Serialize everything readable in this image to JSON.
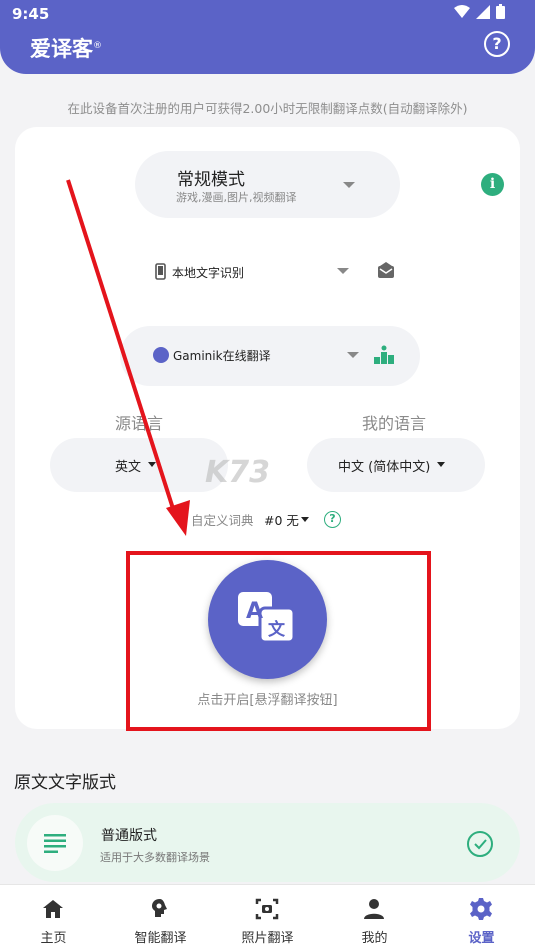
{
  "status_bar": {
    "time": "9:45"
  },
  "header": {
    "app_title": "爱译客",
    "registered_mark": "®",
    "help_icon": "help-circle-icon"
  },
  "notice": "在此设备首次注册的用户可获得2.00小时无限制翻译点数(自动翻译除外)",
  "mode": {
    "title": "常规模式",
    "subtitle": "游戏,漫画,图片,视频翻译"
  },
  "ocr": {
    "label": "本地文字识别"
  },
  "translator": {
    "label": "Gaminik在线翻译"
  },
  "languages": {
    "source_heading": "源语言",
    "target_heading": "我的语言",
    "source_value": "英文",
    "target_value": "中文 (简体中文)"
  },
  "dictionary": {
    "label": "自定义词典",
    "value": "#0 无"
  },
  "float_button": {
    "caption": "点击开启[悬浮翻译按钮]",
    "glyph_a": "A",
    "glyph_zh": "文"
  },
  "watermark": "K73",
  "layout_section": {
    "title": "原文文字版式",
    "option_name": "普通版式",
    "option_desc": "适用于大多数翻译场景"
  },
  "tabs": [
    {
      "label": "主页",
      "icon": "home-icon"
    },
    {
      "label": "智能翻译",
      "icon": "brain-icon"
    },
    {
      "label": "照片翻译",
      "icon": "camera-scan-icon"
    },
    {
      "label": "我的",
      "icon": "person-icon"
    },
    {
      "label": "设置",
      "icon": "gear-icon",
      "active": true
    }
  ],
  "colors": {
    "primary": "#5b63c7",
    "accent_green": "#2eae7e",
    "highlight_red": "#e4141c"
  }
}
